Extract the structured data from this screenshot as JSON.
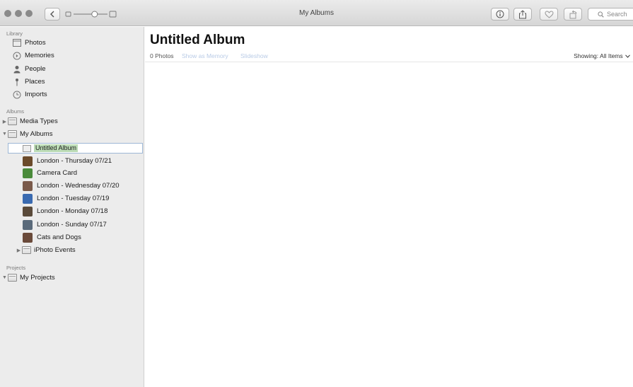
{
  "window": {
    "title": "My Albums"
  },
  "toolbar": {
    "search_placeholder": "Search",
    "buttons": [
      {
        "icon": "back-chevron-icon"
      },
      {
        "icon": "info-icon"
      },
      {
        "icon": "share-icon"
      },
      {
        "icon": "heart-icon"
      },
      {
        "icon": "rotate-icon"
      }
    ],
    "zoom_level": 0.62
  },
  "sidebar": {
    "library_header": "Library",
    "library": [
      {
        "label": "Photos",
        "icon": "photos-icon"
      },
      {
        "label": "Memories",
        "icon": "memories-icon"
      },
      {
        "label": "People",
        "icon": "people-icon"
      },
      {
        "label": "Places",
        "icon": "places-icon"
      },
      {
        "label": "Imports",
        "icon": "imports-icon"
      }
    ],
    "albums_header": "Albums",
    "albums": [
      {
        "label": "Media Types",
        "disclosure": "▶"
      },
      {
        "label": "My Albums",
        "disclosure": "▼"
      }
    ],
    "editing_album": "Untitled Album",
    "my_albums": [
      {
        "label": "London - Thursday 07/21",
        "color": "#6b4a2a"
      },
      {
        "label": "Camera Card",
        "color": "#4a8a3a"
      },
      {
        "label": "London - Wednesday 07/20",
        "color": "#7a5a4a"
      },
      {
        "label": "London - Tuesday 07/19",
        "color": "#3a6ab0"
      },
      {
        "label": "London - Monday 07/18",
        "color": "#5a4a3a"
      },
      {
        "label": "London - Sunday 07/17",
        "color": "#5a6a7a"
      },
      {
        "label": "Cats and Dogs",
        "color": "#6a4a3a"
      }
    ],
    "iphoto_events": {
      "label": "iPhoto Events",
      "disclosure": "▶"
    },
    "projects_header": "Projects",
    "projects": [
      {
        "label": "My Projects",
        "disclosure": "▼"
      }
    ]
  },
  "main": {
    "title": "Untitled Album",
    "count": "0 Photos",
    "show_as_memory": "Show as Memory",
    "slideshow": "Slideshow",
    "showing": "Showing: All Items"
  }
}
